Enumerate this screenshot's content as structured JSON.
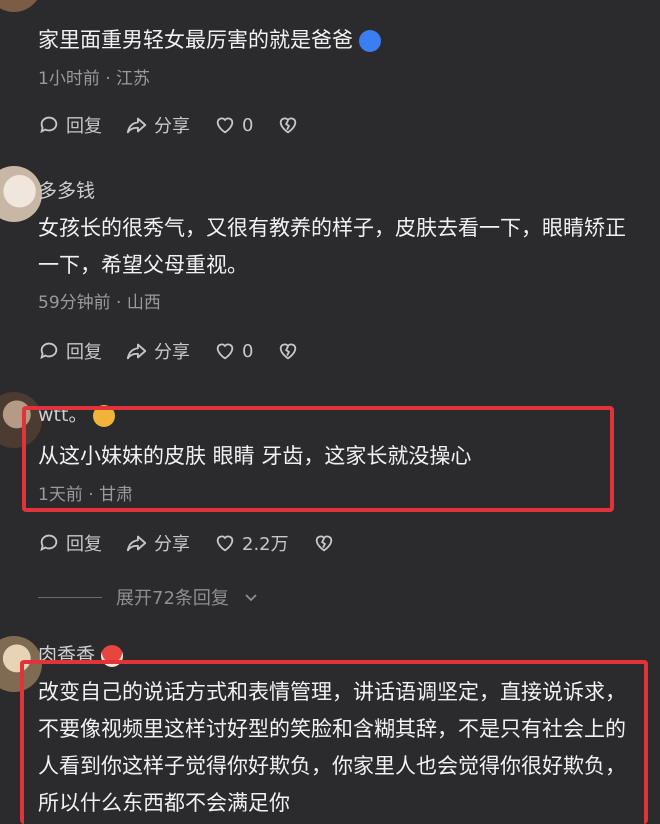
{
  "comments": [
    {
      "username": "",
      "text": "家里面重男轻女最厉害的就是爸爸",
      "time": "1小时前",
      "location": "江苏",
      "reply": "回复",
      "share": "分享",
      "likes": "0"
    },
    {
      "username": "多多钱",
      "text": "女孩长的很秀气，又很有教养的样子，皮肤去看一下，眼睛矫正一下，希望父母重视。",
      "time": "59分钟前",
      "location": "山西",
      "reply": "回复",
      "share": "分享",
      "likes": "0"
    },
    {
      "username": "wtt。",
      "text": "从这小妹妹的皮肤 眼睛 牙齿，这家长就没操心",
      "time": "1天前",
      "location": "甘肃",
      "reply": "回复",
      "share": "分享",
      "likes": "2.2万"
    },
    {
      "username": "肉香香",
      "text": "改变自己的说话方式和表情管理，讲话语调坚定，直接说诉求，不要像视频里这样讨好型的笑脸和含糊其辞，不是只有社会上的人看到你这样子觉得你好欺负，你家里人也会觉得你很好欺负，所以什么东西都不会满足你"
    }
  ],
  "expand_replies": "展开72条回复",
  "separator": "·",
  "colors": {
    "highlight": "#e2323a",
    "background": "#2b2b2d"
  }
}
